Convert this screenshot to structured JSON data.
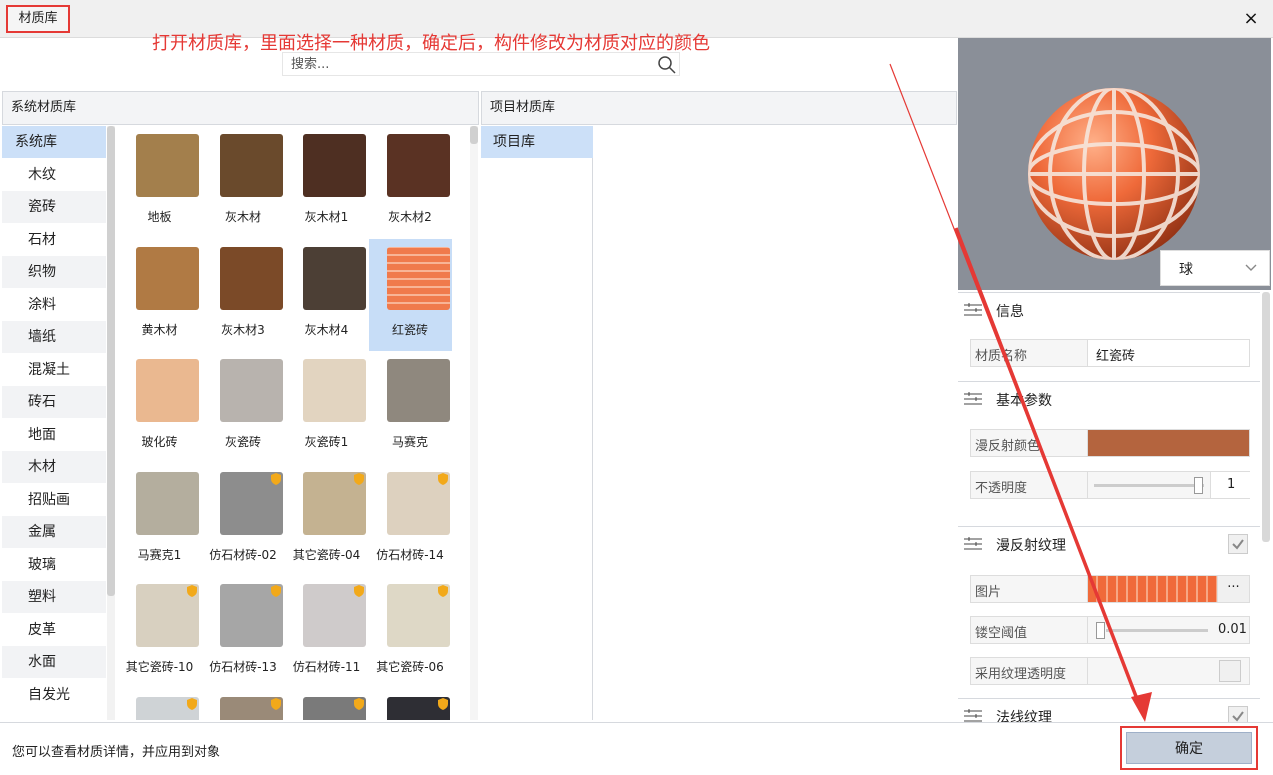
{
  "window": {
    "title": "材质库",
    "close_glyph": "×"
  },
  "annotation": {
    "text": "打开材质库，里面选择一种材质，确定后，构件修改为材质对应的颜色",
    "color": "#e53935"
  },
  "search": {
    "placeholder": "搜索..."
  },
  "system_library": {
    "header": "系统材质库",
    "categories": [
      "系统库",
      "木纹",
      "瓷砖",
      "石材",
      "织物",
      "涂料",
      "墙纸",
      "混凝土",
      "砖石",
      "地面",
      "木材",
      "招贴画",
      "金属",
      "玻璃",
      "塑料",
      "皮革",
      "水面",
      "自发光"
    ],
    "materials": [
      {
        "name": "地板",
        "swatch": "#a37f4c",
        "badge": false
      },
      {
        "name": "灰木材",
        "swatch": "#6a4a2c",
        "badge": false
      },
      {
        "name": "灰木材1",
        "swatch": "#4e2f22",
        "badge": false
      },
      {
        "name": "灰木材2",
        "swatch": "#5a3223",
        "badge": false
      },
      {
        "name": "黄木材",
        "swatch": "#b07a44",
        "badge": false
      },
      {
        "name": "灰木材3",
        "swatch": "#7b4a28",
        "badge": false
      },
      {
        "name": "灰木材4",
        "swatch": "#4c3f35",
        "badge": false
      },
      {
        "name": "红瓷砖",
        "swatch": "#f07a4c",
        "badge": false,
        "selected": true
      },
      {
        "name": "玻化砖",
        "swatch": "#eab890",
        "badge": false
      },
      {
        "name": "灰瓷砖",
        "swatch": "#b8b3ae",
        "badge": false
      },
      {
        "name": "灰瓷砖1",
        "swatch": "#e2d4c0",
        "badge": false
      },
      {
        "name": "马赛克",
        "swatch": "#8f887e",
        "badge": false
      },
      {
        "name": "马赛克1",
        "swatch": "#b4ae9e",
        "badge": false
      },
      {
        "name": "仿石材砖-02",
        "swatch": "#8d8d8d",
        "badge": true
      },
      {
        "name": "其它瓷砖-04",
        "swatch": "#c4b291",
        "badge": true
      },
      {
        "name": "仿石材砖-14",
        "swatch": "#ddd1bf",
        "badge": true
      },
      {
        "name": "其它瓷砖-10",
        "swatch": "#d8d0c0",
        "badge": true
      },
      {
        "name": "仿石材砖-13",
        "swatch": "#a6a6a6",
        "badge": true
      },
      {
        "name": "仿石材砖-11",
        "swatch": "#cfcbcb",
        "badge": true
      },
      {
        "name": "其它瓷砖-06",
        "swatch": "#ded8c6",
        "badge": true
      },
      {
        "name": "",
        "swatch": "#cfd3d6",
        "badge": true
      },
      {
        "name": "",
        "swatch": "#9a8a78",
        "badge": true
      },
      {
        "name": "",
        "swatch": "#7a7a7a",
        "badge": true
      },
      {
        "name": "",
        "swatch": "#2e2e34",
        "badge": true
      }
    ]
  },
  "project_library": {
    "header": "项目材质库",
    "categories": [
      "项目库"
    ]
  },
  "preview": {
    "shape": "球"
  },
  "properties": {
    "info": {
      "title": "信息",
      "name_label": "材质名称",
      "name_value": "红瓷砖"
    },
    "basic": {
      "title": "基本参数",
      "diffuse_label": "漫反射颜色",
      "diffuse_color": "#b4643e",
      "opacity_label": "不透明度",
      "opacity_value": "1"
    },
    "diffuse_texture": {
      "title": "漫反射纹理",
      "image_label": "图片",
      "more": "···",
      "cutout_label": "镂空阈值",
      "cutout_value": "0.01",
      "use_alpha_label": "采用纹理透明度"
    },
    "normal_texture": {
      "title": "法线纹理"
    }
  },
  "status": {
    "text": "您可以查看材质详情，并应用到对象",
    "ok_label": "确定"
  }
}
